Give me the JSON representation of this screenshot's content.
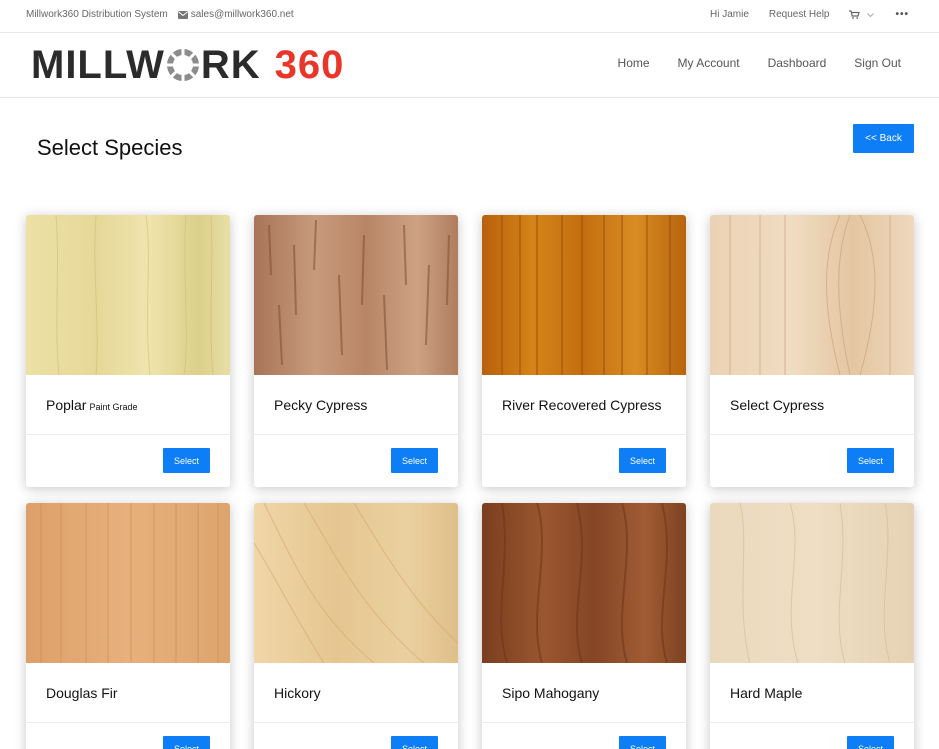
{
  "topbar": {
    "system_name": "Millwork360 Distribution System",
    "email": "sales@millwork360.net",
    "greeting": "Hi Jamie",
    "help": "Request Help",
    "more": "•••"
  },
  "header": {
    "logo_word_left": "MILLW",
    "logo_word_right": "RK",
    "logo_number": "360",
    "nav": [
      "Home",
      "My Account",
      "Dashboard",
      "Sign Out"
    ]
  },
  "page": {
    "title": "Select Species",
    "back_label": "<< Back"
  },
  "species": [
    {
      "name": "Poplar",
      "sub": "Paint Grade",
      "button": "Select"
    },
    {
      "name": "Pecky Cypress",
      "sub": "",
      "button": "Select"
    },
    {
      "name": "River Recovered Cypress",
      "sub": "",
      "button": "Select"
    },
    {
      "name": "Select Cypress",
      "sub": "",
      "button": "Select"
    },
    {
      "name": "Douglas Fir",
      "sub": "",
      "button": "Select"
    },
    {
      "name": "Hickory",
      "sub": "",
      "button": "Select"
    },
    {
      "name": "Sipo Mahogany",
      "sub": "",
      "button": "Select"
    },
    {
      "name": "Hard Maple",
      "sub": "",
      "button": "Select"
    }
  ],
  "colors": {
    "accent": "#0d7ef6",
    "logo_red": "#e8372a",
    "logo_dark": "#2b2b2b"
  }
}
